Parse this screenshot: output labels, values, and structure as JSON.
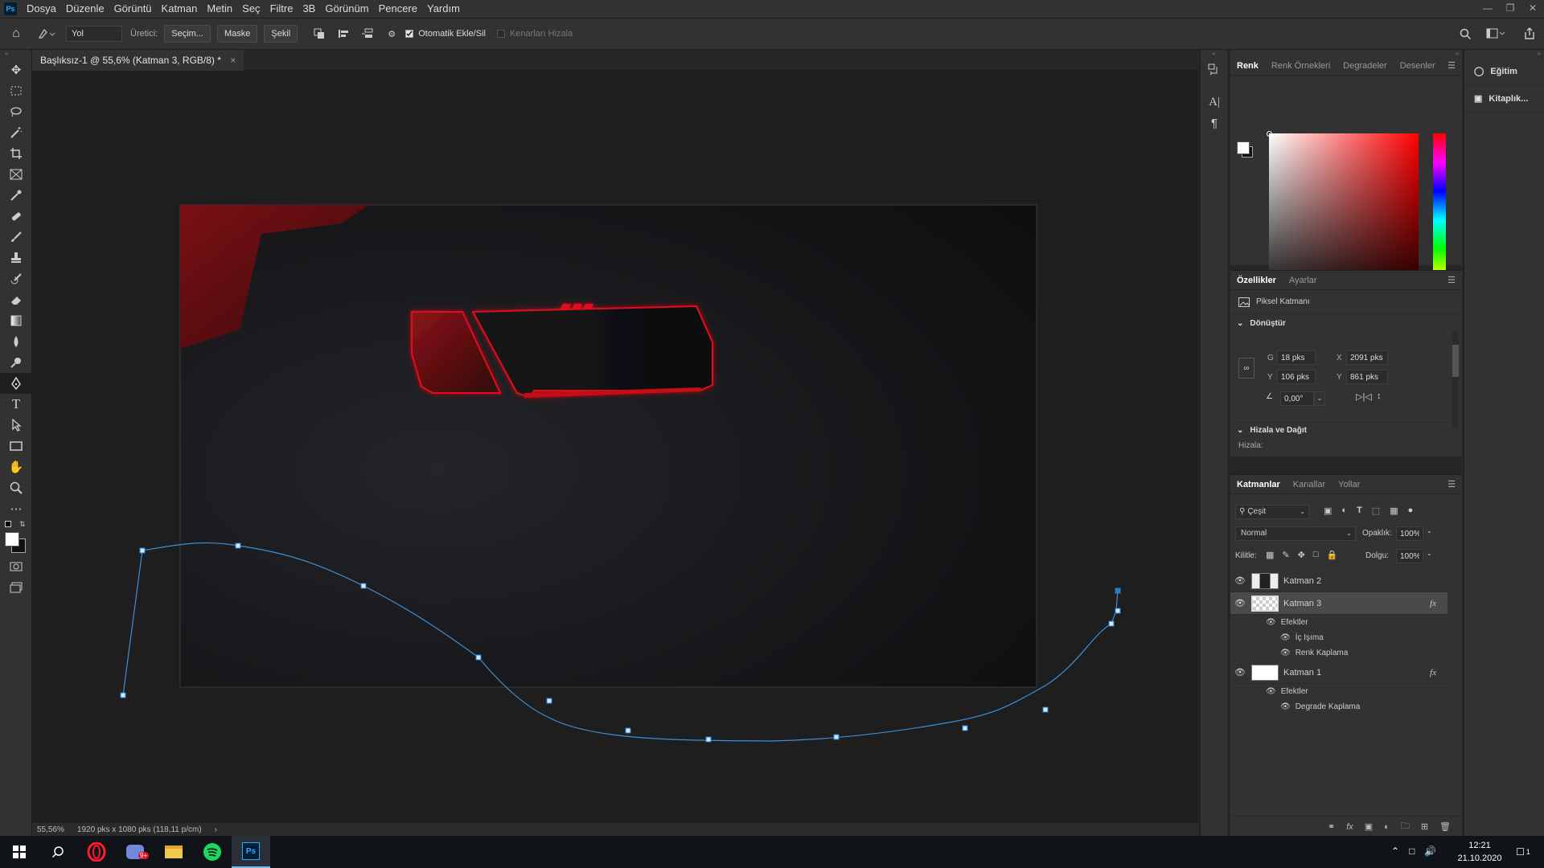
{
  "menu": {
    "app_icon": "Ps",
    "items": [
      "Dosya",
      "Düzenle",
      "Görüntü",
      "Katman",
      "Metin",
      "Seç",
      "Filtre",
      "3B",
      "Görünüm",
      "Pencere",
      "Yardım"
    ]
  },
  "options": {
    "mode_select": "Yol",
    "make_label": "Üretici:",
    "selection_button": "Seçim...",
    "mask_button": "Maske",
    "shape_button": "Şekil",
    "auto_add_delete": "Otomatik Ekle/Sil",
    "align_edges": "Kenarları Hizala"
  },
  "document": {
    "tab_title": "Başlıksız-1 @ 55,6% (Katman 3, RGB/8) *",
    "zoom": "55,56%",
    "doc_info": "1920 pks x 1080 pks (118,11 p/cm)"
  },
  "color_panel": {
    "tabs": [
      "Renk",
      "Renk Örnekleri",
      "Degradeler",
      "Desenler"
    ],
    "active_tab": "Renk",
    "base_hue": "#ff0000"
  },
  "properties_panel": {
    "tabs": [
      "Özellikler",
      "Ayarlar"
    ],
    "layer_type": "Piksel Katmanı",
    "transform_title": "Dönüştür",
    "w_label": "G",
    "w_value": "18 pks",
    "h_label": "Y",
    "h_value": "106 pks",
    "x_label": "X",
    "x_value": "2091 pks",
    "y_label": "Y",
    "y_value": "861 pks",
    "angle_value": "0,00°",
    "align_title": "Hizala ve Dağıt",
    "align_label": "Hizala:"
  },
  "layers_panel": {
    "tabs": [
      "Katmanlar",
      "Kanallar",
      "Yollar"
    ],
    "filter_kind": "Çeşit",
    "blend_mode": "Normal",
    "opacity_label": "Opaklık:",
    "opacity_value": "100%",
    "lock_label": "Kilitle:",
    "fill_label": "Dolgu:",
    "fill_value": "100%",
    "layers": [
      {
        "name": "Katman 2"
      },
      {
        "name": "Katman 3"
      },
      {
        "name": "Katman 1"
      }
    ],
    "effects_label": "Efektler",
    "layer3_effects": [
      "İç Işıma",
      "Renk Kaplama"
    ],
    "layer1_effects": [
      "Degrade Kaplama"
    ],
    "fx_symbol": "fx"
  },
  "learn_panel": {
    "items": [
      "Eğitim",
      "Kitaplık..."
    ]
  },
  "taskbar": {
    "time": "12:21",
    "date": "21.10.2020",
    "notification_count": "1",
    "apps": [
      "windows-start",
      "search",
      "opera",
      "discord",
      "file-explorer",
      "spotify",
      "photoshop"
    ],
    "discord_badge": "9+"
  },
  "colors": {
    "accent_red": "#e0101c",
    "dark_red": "#5a0c10",
    "path_blue": "#3a8fd8",
    "canvas_bg": "#1c1c1f"
  }
}
